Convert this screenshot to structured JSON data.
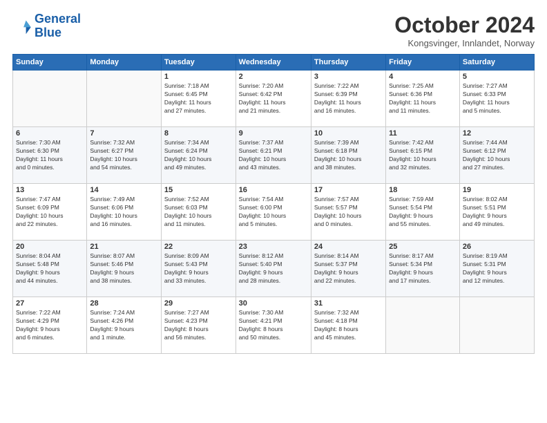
{
  "header": {
    "logo_line1": "General",
    "logo_line2": "Blue",
    "month": "October 2024",
    "location": "Kongsvinger, Innlandet, Norway"
  },
  "weekdays": [
    "Sunday",
    "Monday",
    "Tuesday",
    "Wednesday",
    "Thursday",
    "Friday",
    "Saturday"
  ],
  "weeks": [
    [
      {
        "day": "",
        "info": ""
      },
      {
        "day": "",
        "info": ""
      },
      {
        "day": "1",
        "info": "Sunrise: 7:18 AM\nSunset: 6:45 PM\nDaylight: 11 hours\nand 27 minutes."
      },
      {
        "day": "2",
        "info": "Sunrise: 7:20 AM\nSunset: 6:42 PM\nDaylight: 11 hours\nand 21 minutes."
      },
      {
        "day": "3",
        "info": "Sunrise: 7:22 AM\nSunset: 6:39 PM\nDaylight: 11 hours\nand 16 minutes."
      },
      {
        "day": "4",
        "info": "Sunrise: 7:25 AM\nSunset: 6:36 PM\nDaylight: 11 hours\nand 11 minutes."
      },
      {
        "day": "5",
        "info": "Sunrise: 7:27 AM\nSunset: 6:33 PM\nDaylight: 11 hours\nand 5 minutes."
      }
    ],
    [
      {
        "day": "6",
        "info": "Sunrise: 7:30 AM\nSunset: 6:30 PM\nDaylight: 11 hours\nand 0 minutes."
      },
      {
        "day": "7",
        "info": "Sunrise: 7:32 AM\nSunset: 6:27 PM\nDaylight: 10 hours\nand 54 minutes."
      },
      {
        "day": "8",
        "info": "Sunrise: 7:34 AM\nSunset: 6:24 PM\nDaylight: 10 hours\nand 49 minutes."
      },
      {
        "day": "9",
        "info": "Sunrise: 7:37 AM\nSunset: 6:21 PM\nDaylight: 10 hours\nand 43 minutes."
      },
      {
        "day": "10",
        "info": "Sunrise: 7:39 AM\nSunset: 6:18 PM\nDaylight: 10 hours\nand 38 minutes."
      },
      {
        "day": "11",
        "info": "Sunrise: 7:42 AM\nSunset: 6:15 PM\nDaylight: 10 hours\nand 32 minutes."
      },
      {
        "day": "12",
        "info": "Sunrise: 7:44 AM\nSunset: 6:12 PM\nDaylight: 10 hours\nand 27 minutes."
      }
    ],
    [
      {
        "day": "13",
        "info": "Sunrise: 7:47 AM\nSunset: 6:09 PM\nDaylight: 10 hours\nand 22 minutes."
      },
      {
        "day": "14",
        "info": "Sunrise: 7:49 AM\nSunset: 6:06 PM\nDaylight: 10 hours\nand 16 minutes."
      },
      {
        "day": "15",
        "info": "Sunrise: 7:52 AM\nSunset: 6:03 PM\nDaylight: 10 hours\nand 11 minutes."
      },
      {
        "day": "16",
        "info": "Sunrise: 7:54 AM\nSunset: 6:00 PM\nDaylight: 10 hours\nand 5 minutes."
      },
      {
        "day": "17",
        "info": "Sunrise: 7:57 AM\nSunset: 5:57 PM\nDaylight: 10 hours\nand 0 minutes."
      },
      {
        "day": "18",
        "info": "Sunrise: 7:59 AM\nSunset: 5:54 PM\nDaylight: 9 hours\nand 55 minutes."
      },
      {
        "day": "19",
        "info": "Sunrise: 8:02 AM\nSunset: 5:51 PM\nDaylight: 9 hours\nand 49 minutes."
      }
    ],
    [
      {
        "day": "20",
        "info": "Sunrise: 8:04 AM\nSunset: 5:48 PM\nDaylight: 9 hours\nand 44 minutes."
      },
      {
        "day": "21",
        "info": "Sunrise: 8:07 AM\nSunset: 5:46 PM\nDaylight: 9 hours\nand 38 minutes."
      },
      {
        "day": "22",
        "info": "Sunrise: 8:09 AM\nSunset: 5:43 PM\nDaylight: 9 hours\nand 33 minutes."
      },
      {
        "day": "23",
        "info": "Sunrise: 8:12 AM\nSunset: 5:40 PM\nDaylight: 9 hours\nand 28 minutes."
      },
      {
        "day": "24",
        "info": "Sunrise: 8:14 AM\nSunset: 5:37 PM\nDaylight: 9 hours\nand 22 minutes."
      },
      {
        "day": "25",
        "info": "Sunrise: 8:17 AM\nSunset: 5:34 PM\nDaylight: 9 hours\nand 17 minutes."
      },
      {
        "day": "26",
        "info": "Sunrise: 8:19 AM\nSunset: 5:31 PM\nDaylight: 9 hours\nand 12 minutes."
      }
    ],
    [
      {
        "day": "27",
        "info": "Sunrise: 7:22 AM\nSunset: 4:29 PM\nDaylight: 9 hours\nand 6 minutes."
      },
      {
        "day": "28",
        "info": "Sunrise: 7:24 AM\nSunset: 4:26 PM\nDaylight: 9 hours\nand 1 minute."
      },
      {
        "day": "29",
        "info": "Sunrise: 7:27 AM\nSunset: 4:23 PM\nDaylight: 8 hours\nand 56 minutes."
      },
      {
        "day": "30",
        "info": "Sunrise: 7:30 AM\nSunset: 4:21 PM\nDaylight: 8 hours\nand 50 minutes."
      },
      {
        "day": "31",
        "info": "Sunrise: 7:32 AM\nSunset: 4:18 PM\nDaylight: 8 hours\nand 45 minutes."
      },
      {
        "day": "",
        "info": ""
      },
      {
        "day": "",
        "info": ""
      }
    ]
  ]
}
